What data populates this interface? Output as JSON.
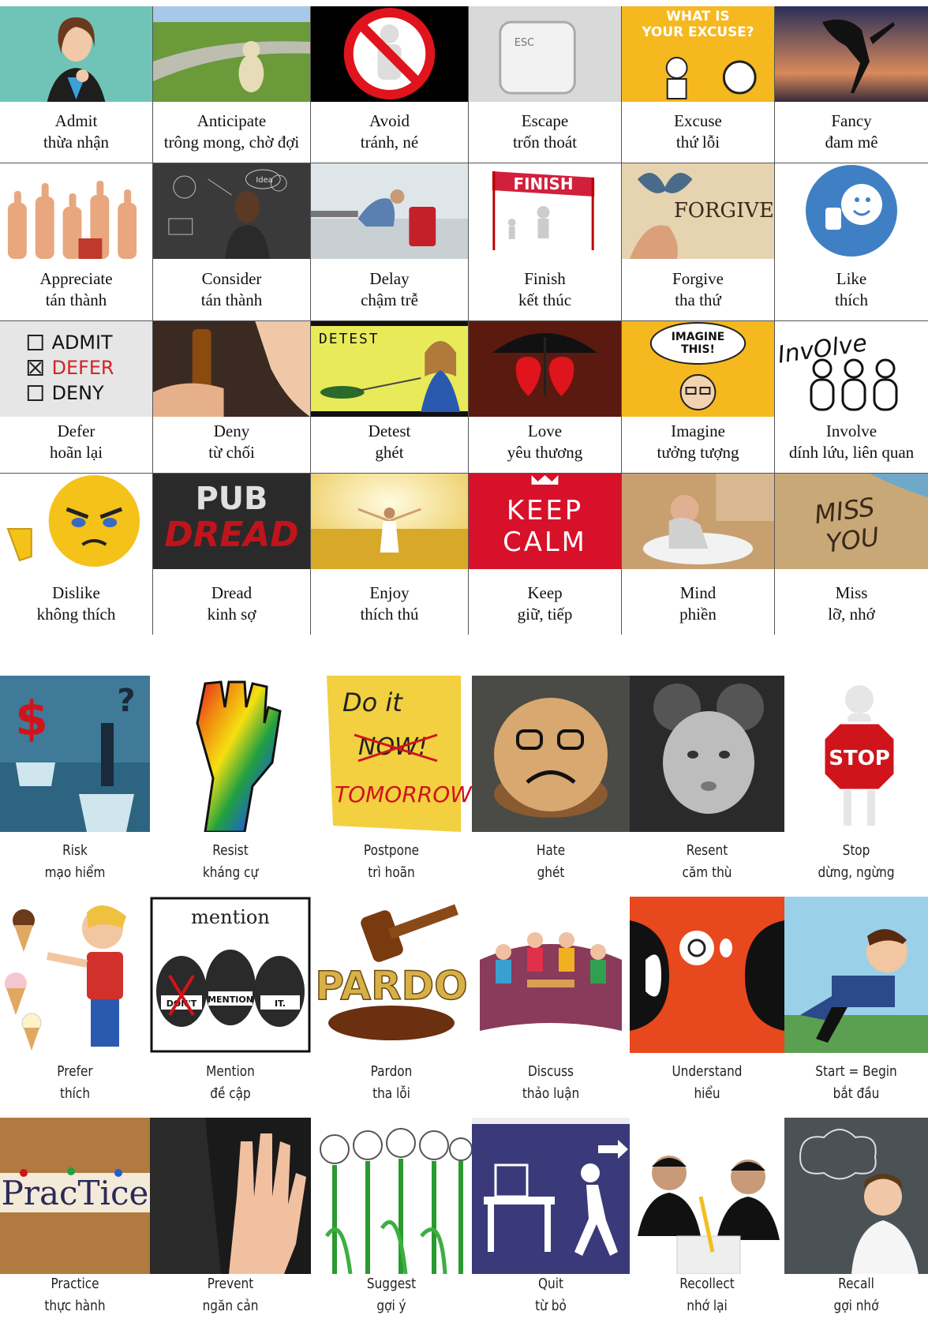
{
  "top_cards": [
    {
      "word": "Admit",
      "meaning": "thừa nhận",
      "icon": "woman-admitting-icon"
    },
    {
      "word": "Anticipate",
      "meaning": "trông mong, chờ đợi",
      "icon": "dog-waiting-icon"
    },
    {
      "word": "Avoid",
      "meaning": "tránh, né",
      "icon": "avoid-sign-icon"
    },
    {
      "word": "Escape",
      "meaning": "trốn thoát",
      "icon": "esc-key-icon",
      "image_text": "ESC"
    },
    {
      "word": "Excuse",
      "meaning": "thứ lỗi",
      "icon": "excuse-poster-icon",
      "image_text": [
        "WHAT IS",
        "YOUR EXCUSE?"
      ]
    },
    {
      "word": "Fancy",
      "meaning": "đam mê",
      "icon": "dancer-silhouette-icon"
    },
    {
      "word": "Appreciate",
      "meaning": "tán thành",
      "icon": "thumbs-up-crowd-icon"
    },
    {
      "word": "Consider",
      "meaning": "tán thành",
      "icon": "thinking-man-icon",
      "image_text": "Idea"
    },
    {
      "word": "Delay",
      "meaning": "chậm trễ",
      "icon": "waiting-traveler-icon"
    },
    {
      "word": "Finish",
      "meaning": "kết thúc",
      "icon": "finish-line-icon",
      "image_text": "FINISH"
    },
    {
      "word": "Forgive",
      "meaning": "tha thứ",
      "icon": "forgive-butterfly-icon",
      "image_text": "FORGIVE"
    },
    {
      "word": "Like",
      "meaning": "thích",
      "icon": "like-smiley-icon"
    },
    {
      "word": "Defer",
      "meaning": "hoãn lại",
      "icon": "checkbox-list-icon",
      "image_text": [
        "ADMIT",
        "DEFER",
        "DENY"
      ]
    },
    {
      "word": "Deny",
      "meaning": "từ chối",
      "icon": "refuse-beer-icon"
    },
    {
      "word": "Detest",
      "meaning": "ghét",
      "icon": "detest-food-icon",
      "image_text": "DETEST"
    },
    {
      "word": "Love",
      "meaning": "yêu thương",
      "icon": "hearts-umbrella-icon"
    },
    {
      "word": "Imagine",
      "meaning": "tưởng tượng",
      "icon": "imagine-bubble-icon",
      "image_text": [
        "IMAGINE",
        "THIS!"
      ]
    },
    {
      "word": "Involve",
      "meaning": "dính lứu, liên quan",
      "icon": "involve-people-icon",
      "image_text": "InvOlve"
    },
    {
      "word": "Dislike",
      "meaning": "không thích",
      "icon": "angry-emoji-icon"
    },
    {
      "word": "Dread",
      "meaning": "kinh sợ",
      "icon": "pub-dread-icon",
      "image_text": [
        "PUB",
        "DREAD"
      ]
    },
    {
      "word": "Enjoy",
      "meaning": "thích thú",
      "icon": "sunny-field-icon"
    },
    {
      "word": "Keep",
      "meaning": "giữ, tiếp",
      "icon": "keep-calm-icon",
      "image_text": [
        "KEEP",
        "CALM"
      ]
    },
    {
      "word": "Mind",
      "meaning": "phiền",
      "icon": "child-sink-icon"
    },
    {
      "word": "Miss",
      "meaning": "lỡ, nhớ",
      "icon": "miss-you-sand-icon",
      "image_text": [
        "MISS",
        "YOU"
      ]
    }
  ],
  "bottom_cards": [
    {
      "word": "Risk",
      "meaning": "mạo hiểm",
      "icon": "risk-iceberg-icon",
      "image_text": "$"
    },
    {
      "word": "Resist",
      "meaning": "kháng cự",
      "icon": "rainbow-fist-icon"
    },
    {
      "word": "Postpone",
      "meaning": "trì hoãn",
      "icon": "sticky-note-icon",
      "image_text": [
        "Do it",
        "NOW!",
        "TOMORROW"
      ]
    },
    {
      "word": "Hate",
      "meaning": "ghét",
      "icon": "frown-wood-icon"
    },
    {
      "word": "Resent",
      "meaning": "căm thù",
      "icon": "pouting-child-icon"
    },
    {
      "word": "Stop",
      "meaning": "dừng, ngừng",
      "icon": "stop-sign-icon",
      "image_text": "STOP"
    },
    {
      "word": "Prefer",
      "meaning": "thích",
      "icon": "ice-cream-kid-icon"
    },
    {
      "word": "Mention",
      "meaning": "đề cập",
      "icon": "mention-faces-icon",
      "image_text": [
        "mention",
        "DON'T",
        "MENTION",
        "IT."
      ]
    },
    {
      "word": "Pardon",
      "meaning": "tha lỗi",
      "icon": "gavel-icon",
      "image_text": "PARDO"
    },
    {
      "word": "Discuss",
      "meaning": "thảo luận",
      "icon": "discussion-group-icon"
    },
    {
      "word": "Understand",
      "meaning": "hiểu",
      "icon": "heads-idea-icon"
    },
    {
      "word": "Start = Begin",
      "meaning": "bắt đầu",
      "icon": "sprinter-icon"
    },
    {
      "word": "Practice",
      "meaning": "thực hành",
      "icon": "practice-letters-icon",
      "image_text": "PracTice"
    },
    {
      "word": "Prevent",
      "meaning": "ngăn cản",
      "icon": "stop-hand-icon"
    },
    {
      "word": "Suggest",
      "meaning": "gợi ý",
      "icon": "lightbulbs-icon"
    },
    {
      "word": "Quit",
      "meaning": "từ bỏ",
      "icon": "exit-desk-icon"
    },
    {
      "word": "Recollect",
      "meaning": "nhớ lại",
      "icon": "students-exam-icon"
    },
    {
      "word": "Recall",
      "meaning": "gợi nhớ",
      "icon": "thinking-chalkboard-icon"
    }
  ]
}
